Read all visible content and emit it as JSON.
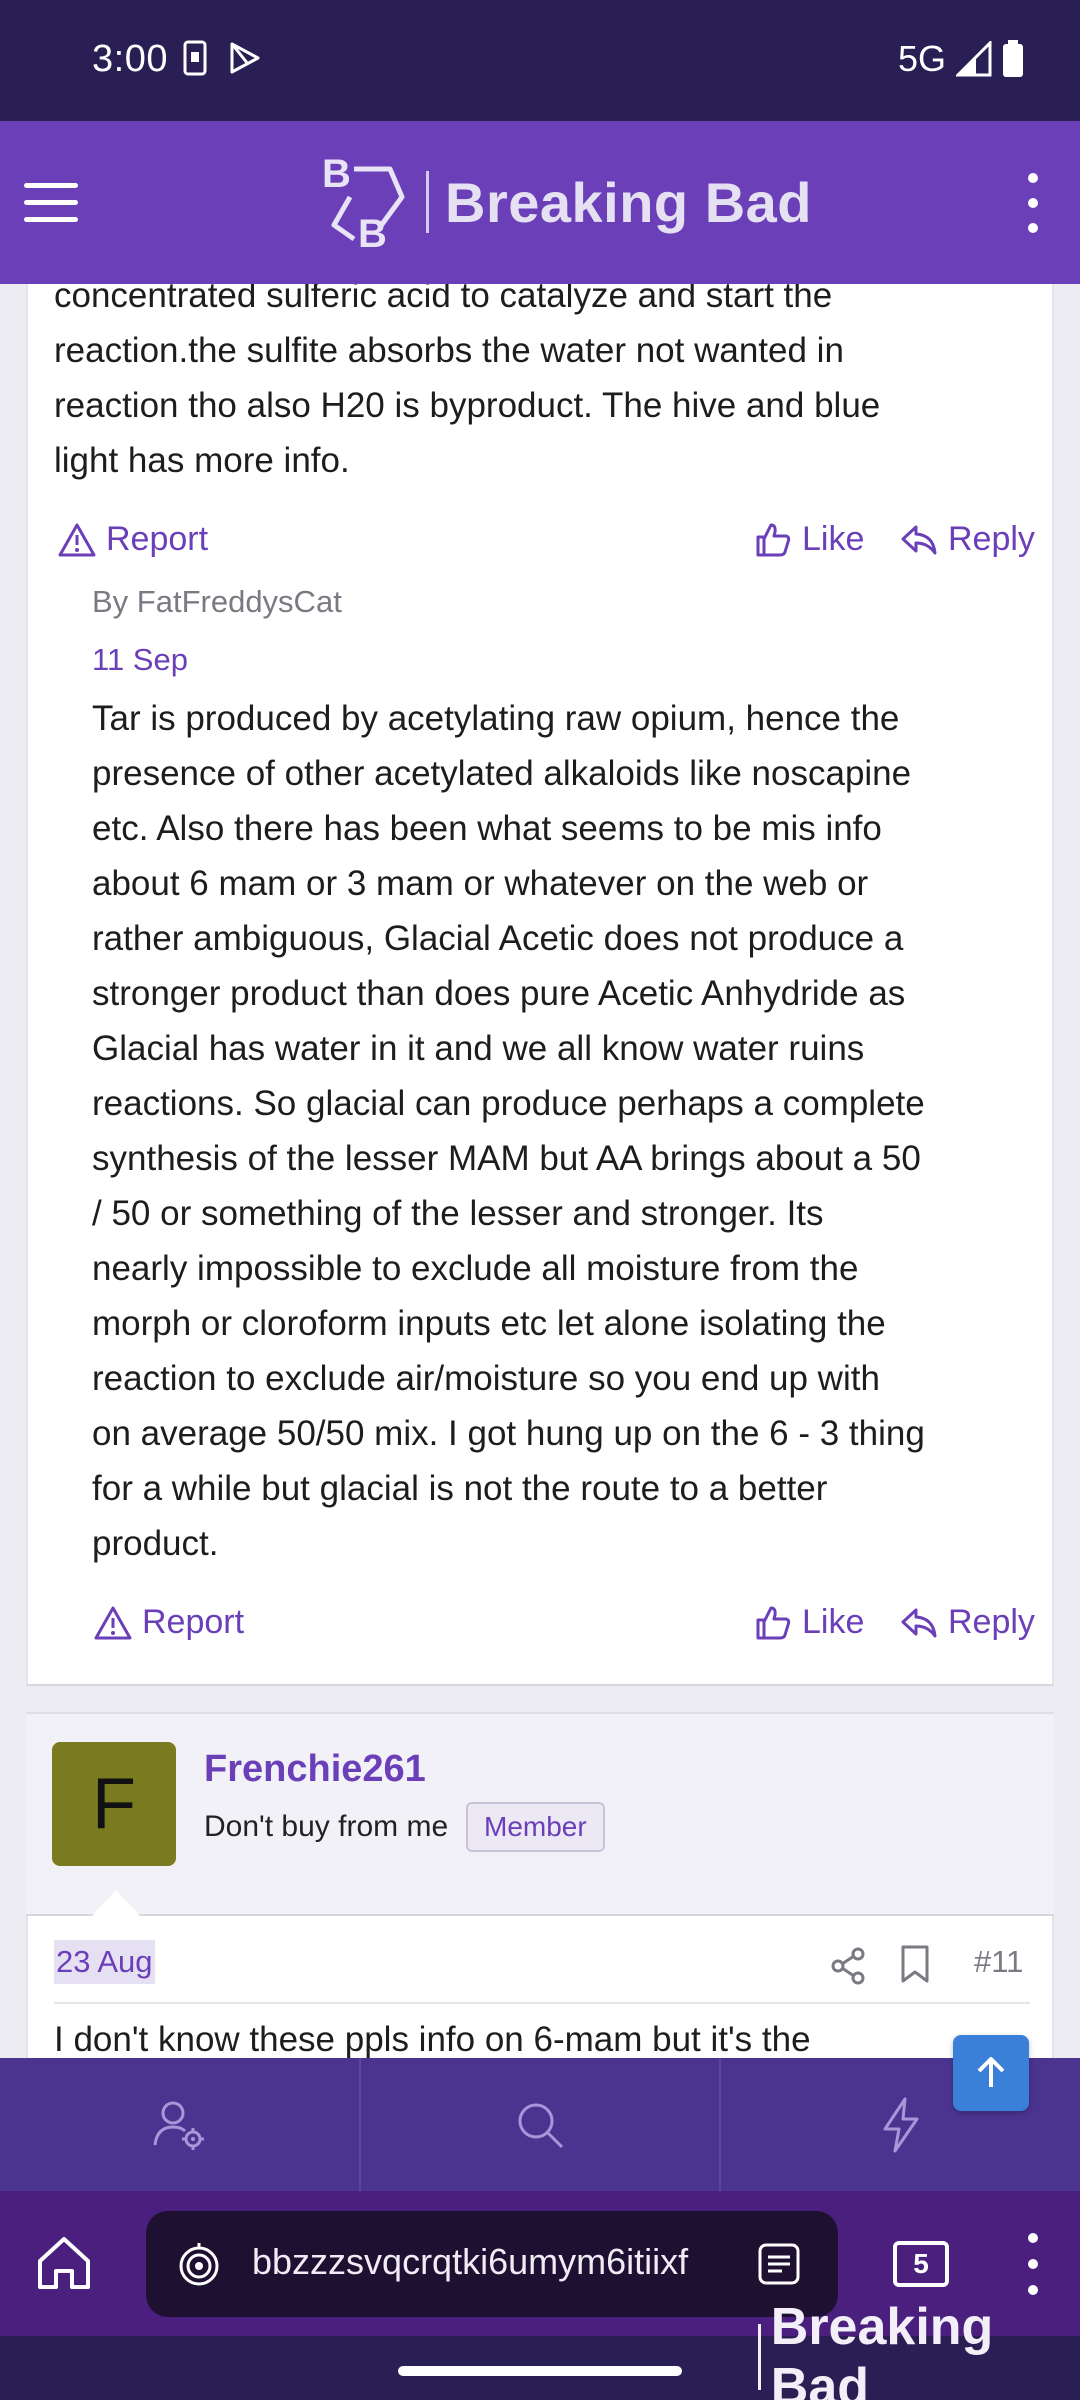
{
  "status_bar": {
    "time": "3:00",
    "network": "5G"
  },
  "header": {
    "site_name": "Breaking Bad"
  },
  "post_top": {
    "text_lines": [
      "concentrated sulferic acid to catalyze and start the",
      "reaction.the sulfite absorbs the water not wanted in",
      "reaction tho also H20 is byproduct. The hive and blue",
      "light has more info."
    ],
    "report_label": "Report",
    "like_label": "Like",
    "reply_label": "Reply"
  },
  "reply": {
    "by_line": "By FatFreddysCat",
    "date": "11 Sep",
    "text_lines": [
      "Tar is produced by acetylating raw opium, hence the",
      "presence of other acetylated alkaloids like noscapine",
      "etc. Also there has been what seems to be mis info",
      "about 6 mam or 3 mam or whatever on the web or",
      "rather ambiguous, Glacial Acetic does not produce a",
      "stronger product than does pure Acetic Anhydride as",
      "Glacial has water in it and we all know water ruins",
      "reactions. So glacial can produce perhaps a complete",
      "synthesis of the lesser MAM but AA brings about a 50",
      "/ 50 or something of the lesser and stronger. Its",
      "nearly impossible to exclude all moisture from the",
      "morph or cloroform inputs etc let alone isolating the",
      "reaction to exclude air/moisture so you end up with",
      "on average 50/50 mix. I got hung up on the 6 - 3 thing",
      "for a while but glacial is not the route to a better",
      "product."
    ],
    "report_label": "Report",
    "like_label": "Like",
    "reply_label": "Reply"
  },
  "next_post": {
    "avatar_letter": "F",
    "username": "Frenchie261",
    "user_title": "Don't buy from me",
    "badge": "Member",
    "date": "23 Aug",
    "post_number": "#11",
    "text_preview": "I don't know these ppls info on 6-mam but it's the"
  },
  "browser": {
    "url": "bbzzzsvqcrqtki6umym6itiixf",
    "tab_count": "5"
  },
  "watermark": "Breaking Bad",
  "colors": {
    "accent": "#6a3fb8",
    "status_bg": "#2a1f55",
    "nav_bg": "#4b3490",
    "browser_bg": "#4a1f7e",
    "avatar_bg": "#7a7a1e"
  }
}
